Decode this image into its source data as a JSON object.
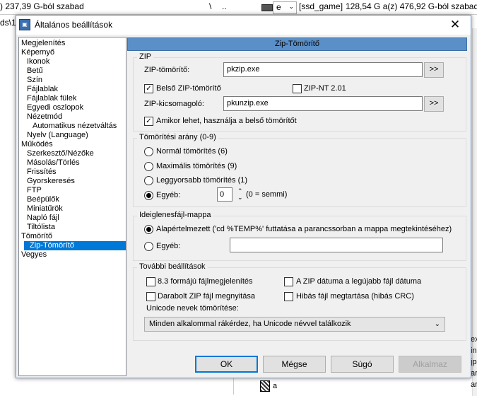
{
  "background": {
    "left_free_space": ") 237,39 G-ból szabad",
    "left_path": "ds\\1",
    "backslash": "\\",
    "dotdot": "..",
    "drive_letter": "e",
    "volume_label": "[ssd_game]",
    "right_free_space": "128,54 G a(z) 476,92 G-ból szabad",
    "right_tail": [
      "ex",
      "in",
      "jp",
      "ar",
      "ar"
    ],
    "bottom_item": "a"
  },
  "dialog": {
    "title": "Általános beállítások",
    "close_glyph": "✕"
  },
  "tree": {
    "items": [
      {
        "label": "Megjelenítés",
        "indent": 0
      },
      {
        "label": "Képernyő",
        "indent": 0
      },
      {
        "label": "Ikonok",
        "indent": 1
      },
      {
        "label": "Betű",
        "indent": 1
      },
      {
        "label": "Szín",
        "indent": 1
      },
      {
        "label": "Fájlablak",
        "indent": 1
      },
      {
        "label": "Fájlablak fülek",
        "indent": 1
      },
      {
        "label": "Egyedi oszlopok",
        "indent": 1
      },
      {
        "label": "Nézetmód",
        "indent": 1
      },
      {
        "label": "Automatikus nézetváltás",
        "indent": 2
      },
      {
        "label": "Nyelv (Language)",
        "indent": 1
      },
      {
        "label": "Működés",
        "indent": 0
      },
      {
        "label": "Szerkesztő/Nézőke",
        "indent": 1
      },
      {
        "label": "Másolás/Törlés",
        "indent": 1
      },
      {
        "label": "Frissítés",
        "indent": 1
      },
      {
        "label": "Gyorskeresés",
        "indent": 1
      },
      {
        "label": "FTP",
        "indent": 1
      },
      {
        "label": "Beépülők",
        "indent": 1
      },
      {
        "label": "Miniatűrök",
        "indent": 1
      },
      {
        "label": "Napló fájl",
        "indent": 1
      },
      {
        "label": "Tiltólista",
        "indent": 1
      },
      {
        "label": "Tömörítő",
        "indent": 0
      },
      {
        "label": "Zip-Tömörítő",
        "indent": 1,
        "selected": true
      },
      {
        "label": "Vegyes",
        "indent": 0
      }
    ]
  },
  "panel": {
    "header": "Zip-Tömörítő",
    "zip_group": {
      "legend": "ZIP",
      "packer_label": "ZIP-tömörítő:",
      "packer_value": "pkzip.exe",
      "browse_label": ">>",
      "internal_zip_label": "Belső ZIP-tömörítő",
      "internal_zip_checked": true,
      "zip_nt_label": "ZIP-NT 2.01",
      "zip_nt_checked": false,
      "unpacker_label": "ZIP-kicsomagoló:",
      "unpacker_value": "pkunzip.exe",
      "use_internal_label": "Amikor lehet, használja a belső tömörítőt",
      "use_internal_checked": true
    },
    "ratio_group": {
      "legend": "Tömörítési arány (0-9)",
      "options": [
        {
          "label": "Normál tömörítés (6)",
          "selected": false
        },
        {
          "label": "Maximális tömörítés (9)",
          "selected": false
        },
        {
          "label": "Leggyorsabb tömörítés (1)",
          "selected": false
        },
        {
          "label": "Egyéb:",
          "selected": true
        }
      ],
      "other_value": "0",
      "other_hint": "(0 = semmi)"
    },
    "temp_group": {
      "legend": "Ideiglenesfájl-mappa",
      "default_label": "Alapértelmezett ('cd %TEMP%' futtatása a parancssorban a mappa megtekintéséhez)",
      "default_selected": true,
      "other_label": "Egyéb:",
      "other_selected": false,
      "other_value": ""
    },
    "extra_group": {
      "legend": "További beállítások",
      "opt_83_label": "8.3 formájú fájlmegjelenítés",
      "opt_83_checked": false,
      "zip_date_label": "A ZIP dátuma a legújabb fájl dátuma",
      "zip_date_checked": false,
      "split_label": "Darabolt ZIP fájl megnyitása",
      "split_checked": false,
      "keep_broken_label": "Hibás fájl megtartása (hibás CRC)",
      "keep_broken_checked": false,
      "unicode_label": "Unicode nevek tömörítése:",
      "unicode_value": "Minden alkalommal rákérdez, ha Unicode névvel találkozik"
    }
  },
  "buttons": {
    "ok": "OK",
    "cancel": "Mégse",
    "help": "Súgó",
    "apply": "Alkalmaz"
  }
}
